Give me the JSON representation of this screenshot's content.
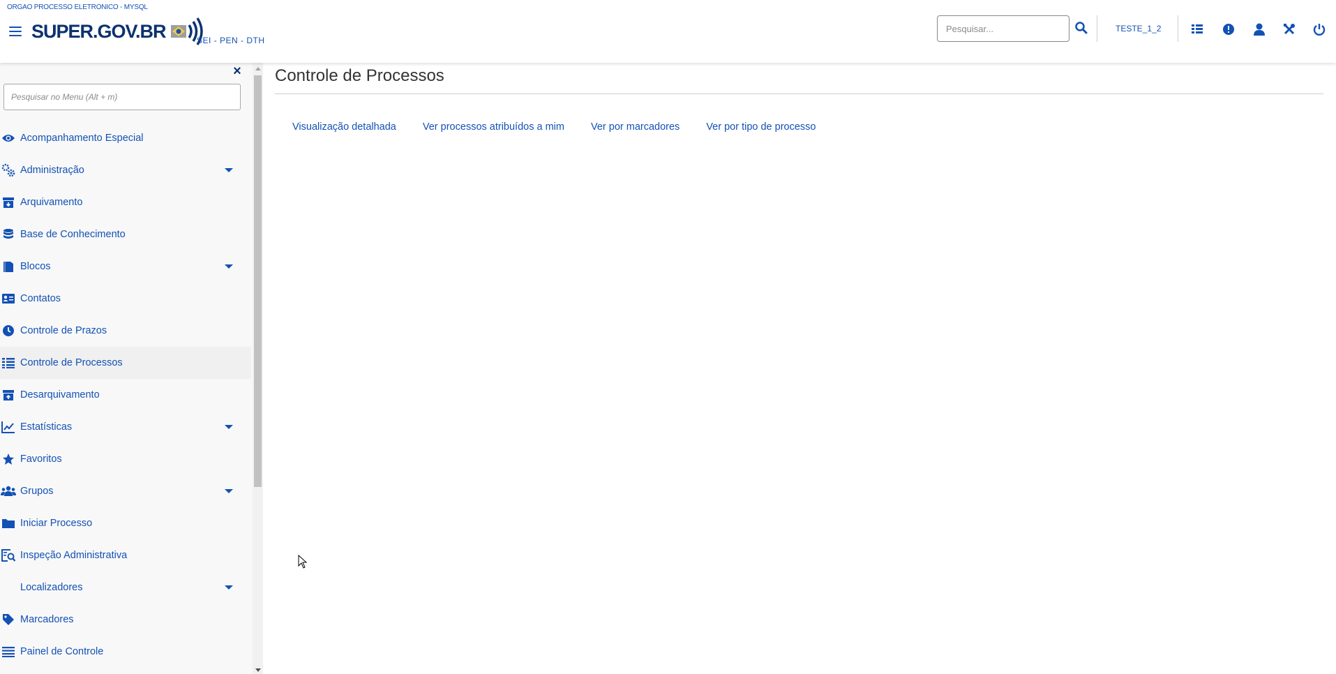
{
  "header": {
    "org_name": "ORGAO PROCESSO ELETRONICO - MYSQL",
    "logo_text": "SUPER.GOV.BR",
    "system_name": "SEI - PEN - DTH",
    "search_placeholder": "Pesquisar...",
    "unit_name": "TESTE_1_2",
    "icons": [
      "grid-icon",
      "alert-icon",
      "user-icon",
      "tools-icon",
      "power-icon"
    ]
  },
  "sidebar": {
    "search_placeholder": "Pesquisar no Menu (Alt + m)",
    "items": [
      {
        "label": "Acompanhamento Especial",
        "icon": "eye-icon",
        "has_submenu": false
      },
      {
        "label": "Administração",
        "icon": "gears-icon",
        "has_submenu": true
      },
      {
        "label": "Arquivamento",
        "icon": "archive-icon",
        "has_submenu": false
      },
      {
        "label": "Base de Conhecimento",
        "icon": "database-icon",
        "has_submenu": false
      },
      {
        "label": "Blocos",
        "icon": "book-icon",
        "has_submenu": true
      },
      {
        "label": "Contatos",
        "icon": "contact-card-icon",
        "has_submenu": false
      },
      {
        "label": "Controle de Prazos",
        "icon": "clock-icon",
        "has_submenu": false
      },
      {
        "label": "Controle de Processos",
        "icon": "list-icon",
        "has_submenu": false,
        "active": true
      },
      {
        "label": "Desarquivamento",
        "icon": "unarchive-icon",
        "has_submenu": false
      },
      {
        "label": "Estatísticas",
        "icon": "chart-line-icon",
        "has_submenu": true
      },
      {
        "label": "Favoritos",
        "icon": "star-icon",
        "has_submenu": false
      },
      {
        "label": "Grupos",
        "icon": "users-icon",
        "has_submenu": true
      },
      {
        "label": "Iniciar Processo",
        "icon": "folder-icon",
        "has_submenu": false
      },
      {
        "label": "Inspeção Administrativa",
        "icon": "inspect-icon",
        "has_submenu": false
      },
      {
        "label": "Localizadores",
        "icon": "",
        "has_submenu": true
      },
      {
        "label": "Marcadores",
        "icon": "tag-icon",
        "has_submenu": false
      },
      {
        "label": "Painel de Controle",
        "icon": "bars-icon",
        "has_submenu": false
      }
    ]
  },
  "main": {
    "title": "Controle de Processos",
    "tabs": [
      "Visualização detalhada",
      "Ver processos atribuídos a mim",
      "Ver por marcadores",
      "Ver por tipo de processo"
    ]
  },
  "colors": {
    "brand_blue": "#1351b4",
    "brand_dark": "#0c326f",
    "sidebar_bg": "#f8f8f8"
  }
}
